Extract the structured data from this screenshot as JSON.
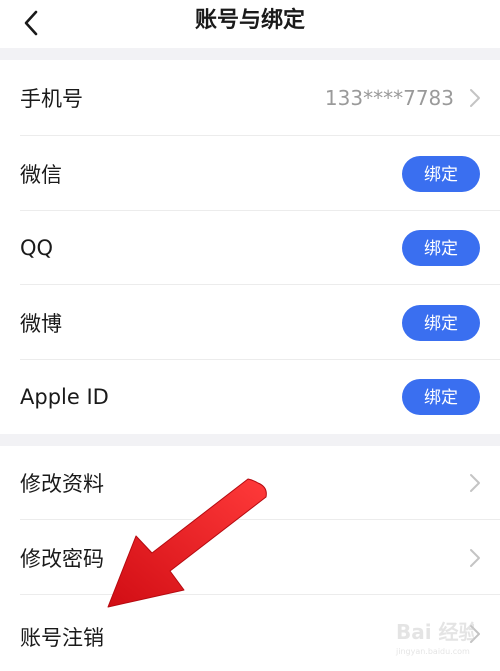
{
  "nav": {
    "title": "账号与绑定"
  },
  "bind_section": [
    {
      "label": "手机号",
      "value": "133****7783"
    },
    {
      "label": "微信",
      "button": "绑定"
    },
    {
      "label": "QQ",
      "button": "绑定"
    },
    {
      "label": "微博",
      "button": "绑定"
    },
    {
      "label": "Apple ID",
      "button": "绑定"
    }
  ],
  "settings_section": [
    {
      "label": "修改资料"
    },
    {
      "label": "修改密码"
    },
    {
      "label": "账号注销"
    }
  ],
  "watermark": {
    "text": "Bai 经验",
    "url": "jingyan.baidu.com"
  },
  "colors": {
    "accent": "#3a6ff0",
    "annotation_arrow": "#e8141b"
  }
}
